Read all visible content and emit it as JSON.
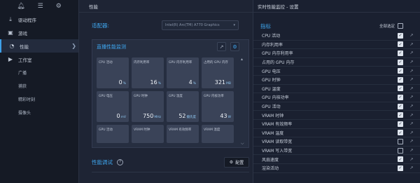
{
  "sidebar": {
    "top_icons": [
      "bell-icon",
      "menu-icon",
      "gear-icon"
    ],
    "items": [
      {
        "label": "驱动程序",
        "icon": "download-icon"
      },
      {
        "label": "游戏",
        "icon": "games-icon"
      },
      {
        "label": "性能",
        "icon": "performance-icon",
        "active": true
      },
      {
        "label": "工作室",
        "icon": "camera-icon"
      }
    ],
    "sub_items": [
      "广播",
      "捕获",
      "精彩时刻",
      "摄像头"
    ]
  },
  "main": {
    "title": "性能",
    "adapter_label": "适配器:",
    "adapter_value": "Intel(R) Arc(TM) A770 Graphics",
    "monitor_title": "直播性能监测",
    "tiles": [
      {
        "label": "CPU 活动",
        "value": "0",
        "unit": "%"
      },
      {
        "label": "内存利用率",
        "value": "16",
        "unit": "%"
      },
      {
        "label": "GPU 内存利用率",
        "value": "4",
        "unit": "%"
      },
      {
        "label": "占用的 GPU 内存",
        "value": "321",
        "unit": "MB"
      },
      {
        "label": "GPU 电压",
        "value": "0",
        "unit": "mV"
      },
      {
        "label": "GPU 时钟",
        "value": "750",
        "unit": "MHz"
      },
      {
        "label": "GPU 温度",
        "value": "52",
        "unit": "摄氏度"
      },
      {
        "label": "GPU 内核功率",
        "value": "43",
        "unit": "W"
      },
      {
        "label": "GPU 活动",
        "value": "",
        "unit": ""
      },
      {
        "label": "VRAM 时钟",
        "value": "",
        "unit": ""
      },
      {
        "label": "VRAM 有效频率",
        "value": "",
        "unit": ""
      },
      {
        "label": "VRAM 温度",
        "value": "",
        "unit": ""
      }
    ],
    "tuning_label": "性能调试",
    "config_label": "配置"
  },
  "right": {
    "title": "实时性能监控 - 设置",
    "metrics_label": "指标",
    "select_all_label": "全部选定",
    "select_all_checked": false,
    "metrics": [
      {
        "label": "CPU 活动",
        "checked": true
      },
      {
        "label": "内存利用率",
        "checked": true
      },
      {
        "label": "GPU 内存利用率",
        "checked": true
      },
      {
        "label": "占用的 GPU 内存",
        "checked": true
      },
      {
        "label": "GPU 电压",
        "checked": true
      },
      {
        "label": "GPU 时钟",
        "checked": true
      },
      {
        "label": "GPU 温度",
        "checked": true
      },
      {
        "label": "GPU 内核功率",
        "checked": true
      },
      {
        "label": "GPU 活动",
        "checked": true
      },
      {
        "label": "VRAM 时钟",
        "checked": true
      },
      {
        "label": "VRAM 有效频率",
        "checked": true
      },
      {
        "label": "VRAM 温度",
        "checked": true
      },
      {
        "label": "VRAM 读取带宽",
        "checked": false
      },
      {
        "label": "VRAM 写入带宽",
        "checked": false
      },
      {
        "label": "风扇速度",
        "checked": true
      },
      {
        "label": "渲染活动",
        "checked": true
      }
    ]
  }
}
